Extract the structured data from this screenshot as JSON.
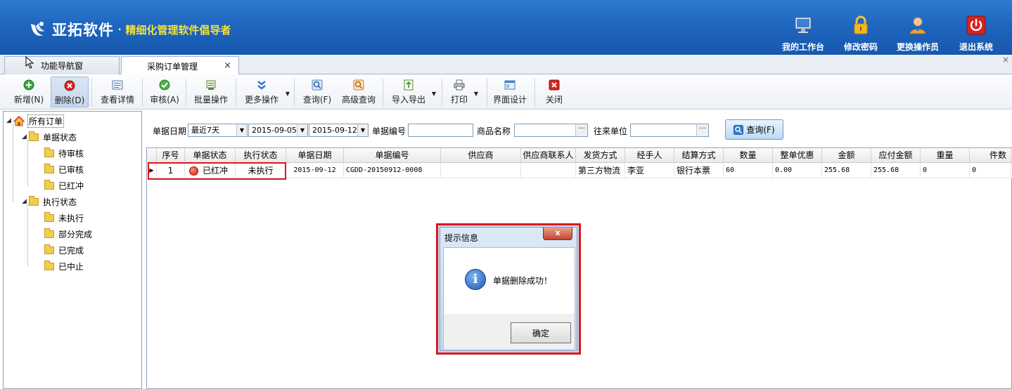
{
  "header": {
    "brand_name": "亚拓软件",
    "brand_dot": "·",
    "slogan": "精细化管理软件倡导者",
    "buttons": [
      {
        "label": "我的工作台",
        "icon": "monitor-icon"
      },
      {
        "label": "修改密码",
        "icon": "lock-icon"
      },
      {
        "label": "更换操作员",
        "icon": "user-icon"
      },
      {
        "label": "退出系统",
        "icon": "power-icon"
      }
    ]
  },
  "tabs": {
    "nav_label": "功能导航窗",
    "active_label": "采购订单管理",
    "close_glyph": "×",
    "window_close_glyph": "×"
  },
  "toolbar": {
    "add": "新增(N)",
    "delete": "删除(D)",
    "view_detail": "查看详情",
    "audit": "审核(A)",
    "batch": "批量操作",
    "more": "更多操作",
    "query": "查询(F)",
    "advanced_query": "高级查询",
    "import_export": "导入导出",
    "print": "打印",
    "ui_design": "界面设计",
    "close": "关闭",
    "dropdown_glyph": "▼"
  },
  "tree": {
    "root": "所有订单",
    "groups": [
      {
        "label": "单据状态",
        "items": [
          "待审核",
          "已审核",
          "已红冲"
        ]
      },
      {
        "label": "执行状态",
        "items": [
          "未执行",
          "部分完成",
          "已完成",
          "已中止"
        ]
      }
    ]
  },
  "filter": {
    "date_label": "单据日期",
    "date_range": "最近7天",
    "date_from": "2015-09-05",
    "date_to": "2015-09-12",
    "docno_label": "单据编号",
    "goods_label": "商品名称",
    "partner_label": "往来单位",
    "query_button": "查询(F)",
    "dots": "···",
    "arrow": "▼"
  },
  "grid": {
    "columns": [
      "序号",
      "单据状态",
      "执行状态",
      "单据日期",
      "单据编号",
      "供应商",
      "供应商联系人",
      "发货方式",
      "经手人",
      "结算方式",
      "数量",
      "整单优惠",
      "金额",
      "应付金额",
      "重量",
      "件数"
    ],
    "rows": [
      {
        "indicator": "▶",
        "seq": "1",
        "doc_status": "已红冲",
        "exec_status": "未执行",
        "date": "2015-09-12",
        "doc_no": "CGDD-20150912-0008",
        "supplier": "",
        "contact": "",
        "ship_method": "第三方物流",
        "handler": "李亚",
        "settle": "银行本票",
        "qty": "60",
        "discount": "0.00",
        "amount": "255.68",
        "payable": "255.68",
        "weight": "0",
        "pieces": "0"
      }
    ]
  },
  "dialog": {
    "title": "提示信息",
    "close_glyph": "x",
    "info_glyph": "i",
    "message": "单据删除成功！",
    "ok_button": "确定"
  },
  "colors": {
    "header_blue": "#1f66bf",
    "slogan_yellow": "#f5e23a",
    "highlight_red": "#e0161b"
  }
}
